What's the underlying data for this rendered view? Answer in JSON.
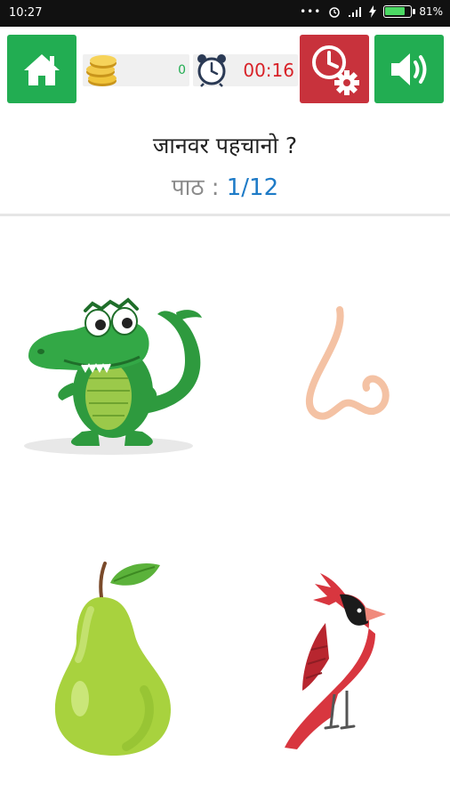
{
  "status_bar": {
    "time": "10:27",
    "icons": [
      "more-icon",
      "alarm-icon",
      "signal-icon",
      "charging-icon",
      "battery-icon"
    ],
    "battery_percent": "81%",
    "battery_level": 0.81
  },
  "toolbar": {
    "home_icon": "home-icon",
    "coins_icon": "coin-stack-icon",
    "coins": "0",
    "timer_icon": "alarm-clock-icon",
    "timer": "00:16",
    "timer_settings_icon": "clock-settings-icon",
    "sound_icon": "speaker-icon"
  },
  "quiz": {
    "question": "जानवर पहचानो ?",
    "lesson_label": "पाठ :",
    "lesson_progress": "1/12"
  },
  "options": [
    {
      "name": "crocodile"
    },
    {
      "name": "nose"
    },
    {
      "name": "pear"
    },
    {
      "name": "cardinal-bird"
    }
  ],
  "colors": {
    "green_button": "#22ad52",
    "red_button": "#c8323c",
    "timer_text": "#d82228",
    "lesson_value": "#1e7bc7"
  }
}
